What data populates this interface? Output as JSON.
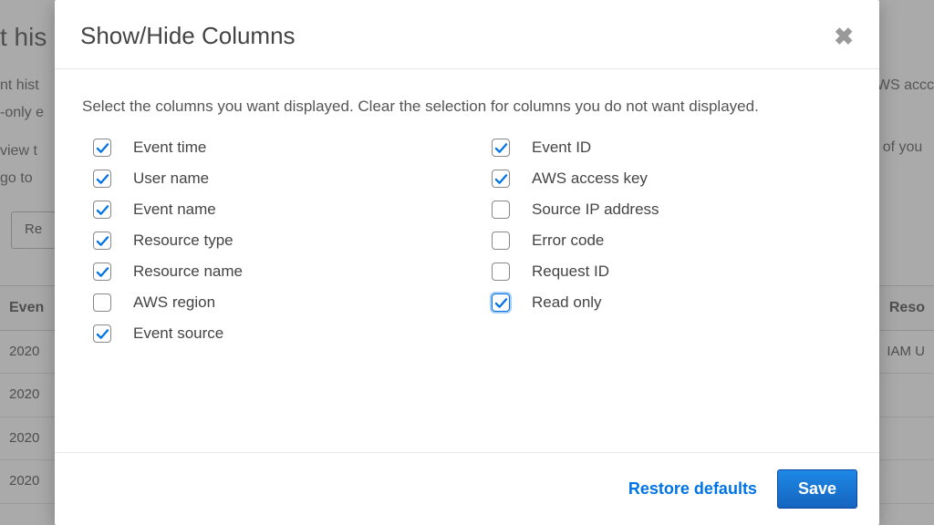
{
  "background": {
    "title_fragment": "t his",
    "line1": "nt hist",
    "line2": "-only e",
    "line3": "view t",
    "line4": " go to",
    "right1": "r AWS accc",
    "right2": "log of you",
    "filter": "Re",
    "th1": "Even",
    "th2": "Reso",
    "rows": [
      "2020",
      "2020",
      "2020",
      "2020"
    ],
    "rcell": "IAM U"
  },
  "modal": {
    "title": "Show/Hide Columns",
    "description": "Select the columns you want displayed. Clear the selection for columns you do not want displayed.",
    "left": [
      {
        "label": "Event time",
        "checked": true,
        "focused": false
      },
      {
        "label": "User name",
        "checked": true,
        "focused": false
      },
      {
        "label": "Event name",
        "checked": true,
        "focused": false
      },
      {
        "label": "Resource type",
        "checked": true,
        "focused": false
      },
      {
        "label": "Resource name",
        "checked": true,
        "focused": false
      },
      {
        "label": "AWS region",
        "checked": false,
        "focused": false
      },
      {
        "label": "Event source",
        "checked": true,
        "focused": false
      }
    ],
    "right": [
      {
        "label": "Event ID",
        "checked": true,
        "focused": false
      },
      {
        "label": "AWS access key",
        "checked": true,
        "focused": false
      },
      {
        "label": "Source IP address",
        "checked": false,
        "focused": false
      },
      {
        "label": "Error code",
        "checked": false,
        "focused": false
      },
      {
        "label": "Request ID",
        "checked": false,
        "focused": false
      },
      {
        "label": "Read only",
        "checked": true,
        "focused": true
      }
    ],
    "restore": "Restore defaults",
    "save": "Save"
  }
}
